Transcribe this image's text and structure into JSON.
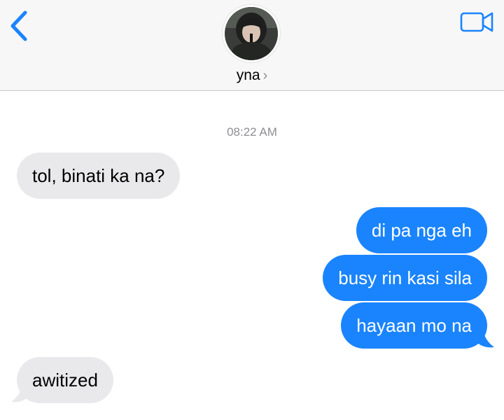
{
  "contact": {
    "name": "yna",
    "chevron": "›"
  },
  "icons": {
    "back": "chevron-left-icon",
    "video": "video-camera-icon"
  },
  "colors": {
    "accent": "#1a84ff",
    "incoming_bubble": "#e9e9eb",
    "header_bg": "#f7f7f7",
    "timestamp_text": "#8e8e93"
  },
  "conversation": {
    "timestamp": "08:22 AM",
    "messages": [
      {
        "direction": "incoming",
        "text": "tol, binati ka na?"
      },
      {
        "direction": "outgoing",
        "text": "di pa nga eh"
      },
      {
        "direction": "outgoing",
        "text": "busy rin kasi sila"
      },
      {
        "direction": "outgoing",
        "text": "hayaan mo na"
      },
      {
        "direction": "incoming",
        "text": "awitized"
      }
    ]
  }
}
